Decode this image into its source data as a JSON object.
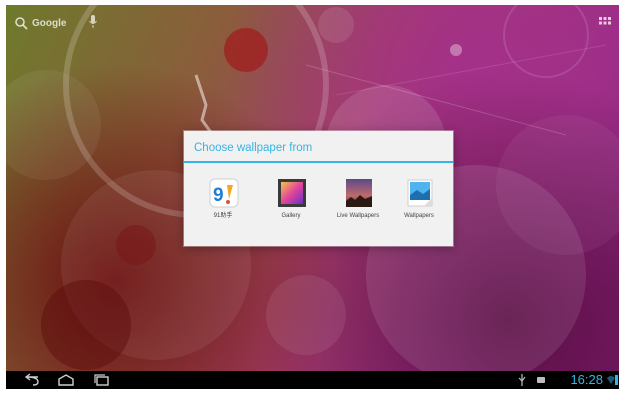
{
  "home": {
    "search_label": "Google",
    "icons": {
      "search": "search-icon",
      "mic": "mic-icon",
      "apps": "all-apps-icon"
    }
  },
  "dialog": {
    "title": "Choose wallpaper from",
    "options": [
      {
        "label": "91助手",
        "icon": "app-91-icon"
      },
      {
        "label": "Gallery",
        "icon": "gallery-icon"
      },
      {
        "label": "Live Wallpapers",
        "icon": "live-wallpapers-icon"
      },
      {
        "label": "Wallpapers",
        "icon": "wallpapers-icon"
      }
    ]
  },
  "status_bar": {
    "time": "16:28",
    "icons": [
      "back-icon",
      "home-icon",
      "recent-apps-icon",
      "usb-icon",
      "notification-icon",
      "wifi-icon",
      "battery-icon"
    ]
  },
  "colors": {
    "accent": "#33b5e5",
    "dialog_bg": "#f1f1f1",
    "navbar_bg": "#000000"
  }
}
